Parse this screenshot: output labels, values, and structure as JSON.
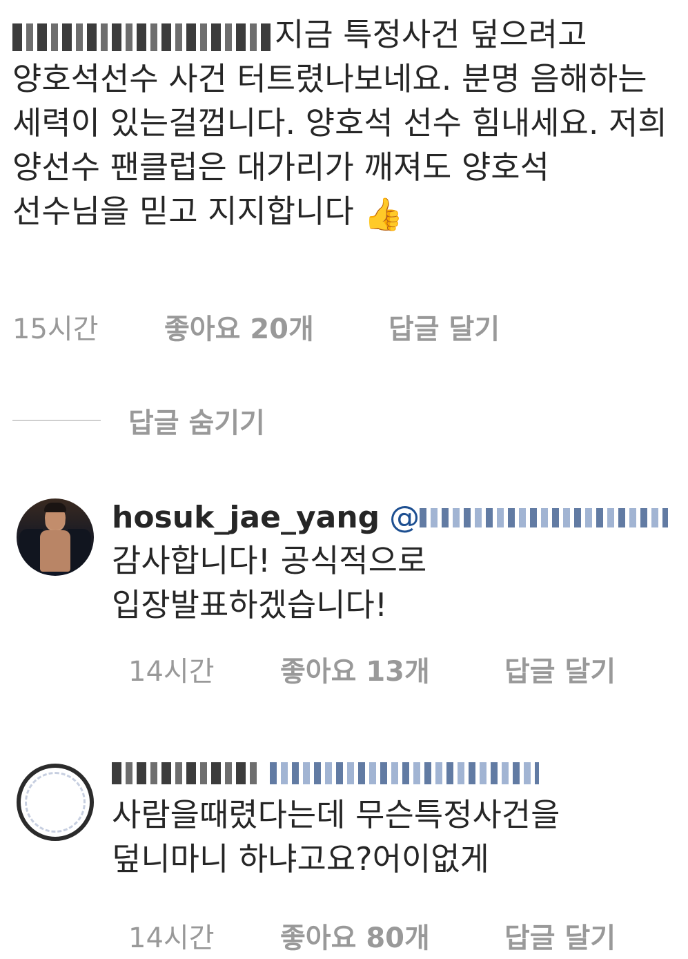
{
  "comment_main": {
    "username_masked": true,
    "text": "지금 특정사건 덮으려고 양호석선수 사건 터트렸나보네요. 분명 음해하는 세력이 있는걸껍니다. 양호석 선수 힘내세요. 저희 양선수 팬클럽은 대가리가 깨져도 양호석 선수님을 믿고 지지합니다",
    "emoji": "👍",
    "time": "15시간",
    "likes": "좋아요 20개",
    "reply_action": "답글 달기"
  },
  "hide_replies": {
    "label": "답글 숨기기"
  },
  "replies": [
    {
      "username": "hosuk_jae_yang",
      "mention_prefix": "@",
      "avatar_icon": "profile-photo-man-in-suit",
      "text_line1": "감사합니다! 공식적으로",
      "text_line2": "입장발표하겠습니다!",
      "time": "14시간",
      "likes": "좋아요 13개",
      "reply_action": "답글 달기"
    },
    {
      "username_masked": true,
      "avatar_icon": "profile-photo-ring",
      "text_line1": "사람을때렸다는데 무슨특정사건을",
      "text_line2": "덮니마니 하냐고요?어이없게",
      "time": "14시간",
      "likes": "좋아요 80개",
      "reply_action": "답글 달기"
    }
  ]
}
